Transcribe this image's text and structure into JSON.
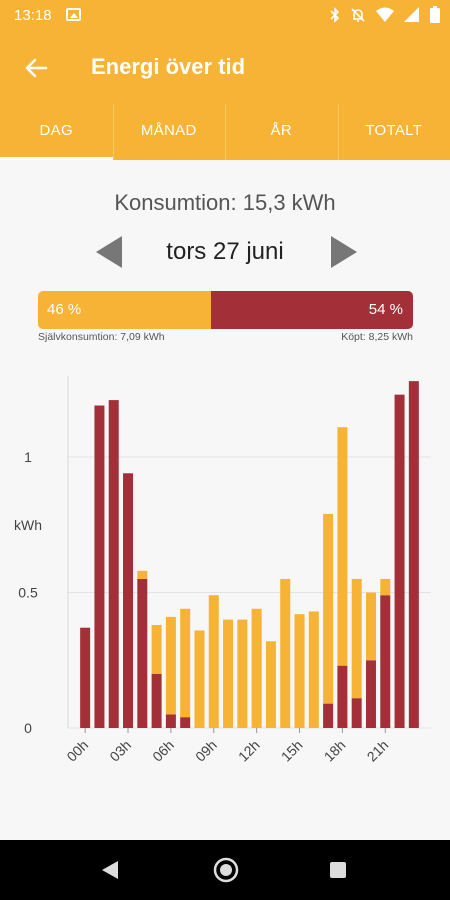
{
  "status_bar": {
    "time": "13:18",
    "icons": [
      "image-icon",
      "bluetooth-icon",
      "mute-icon",
      "wifi-icon",
      "signal-icon",
      "battery-icon"
    ]
  },
  "app_bar": {
    "title": "Energi över tid",
    "back_icon": "arrow-back-icon"
  },
  "tabs": [
    {
      "label": "DAG",
      "active": true
    },
    {
      "label": "MÅNAD",
      "active": false
    },
    {
      "label": "ÅR",
      "active": false
    },
    {
      "label": "TOTALT",
      "active": false
    }
  ],
  "summary": {
    "consumption": "Konsumtion: 15,3 kWh",
    "date": "tors 27 juni"
  },
  "split": {
    "self_percent": "46 %",
    "bought_percent": "54 %",
    "self_fraction": 0.46,
    "self_label": "Självkonsumtion: 7,09 kWh",
    "bought_label": "Köpt: 8,25 kWh"
  },
  "colors": {
    "accent": "#f7b335",
    "bought": "#a33038",
    "self": "#f7b335"
  },
  "chart_data": {
    "type": "bar",
    "stacked": true,
    "ylabel": "kWh",
    "ylim": [
      0,
      1.3
    ],
    "yticks": [
      {
        "value": 0,
        "label": "0"
      },
      {
        "value": 0.5,
        "label": "0.5"
      },
      {
        "value": 1,
        "label": "1"
      }
    ],
    "xticks": [
      {
        "index": 0,
        "label": "00h"
      },
      {
        "index": 3,
        "label": "03h"
      },
      {
        "index": 6,
        "label": "06h"
      },
      {
        "index": 9,
        "label": "09h"
      },
      {
        "index": 12,
        "label": "12h"
      },
      {
        "index": 15,
        "label": "15h"
      },
      {
        "index": 18,
        "label": "18h"
      },
      {
        "index": 21,
        "label": "21h"
      }
    ],
    "categories": [
      "00",
      "01",
      "02",
      "03",
      "04",
      "05",
      "06",
      "07",
      "08",
      "09",
      "10",
      "11",
      "12",
      "13",
      "14",
      "15",
      "16",
      "17",
      "18",
      "19",
      "20",
      "21",
      "22",
      "23"
    ],
    "series": [
      {
        "key": "bought",
        "values": [
          0.37,
          1.19,
          1.21,
          0.94,
          0.55,
          0.2,
          0.05,
          0.04,
          0,
          0,
          0,
          0,
          0,
          0,
          0,
          0,
          0,
          0.09,
          0.23,
          0.11,
          0.25,
          0.49,
          1.23,
          1.28
        ]
      },
      {
        "key": "self",
        "values": [
          0,
          0,
          0,
          0,
          0.03,
          0.18,
          0.36,
          0.4,
          0.36,
          0.49,
          0.4,
          0.4,
          0.44,
          0.32,
          0.55,
          0.42,
          0.43,
          0.7,
          0.88,
          0.44,
          0.25,
          0.06,
          0,
          0
        ]
      }
    ]
  },
  "nav_bar": {
    "back": "back-triangle-icon",
    "home": "home-circle-icon",
    "recent": "recent-square-icon"
  }
}
